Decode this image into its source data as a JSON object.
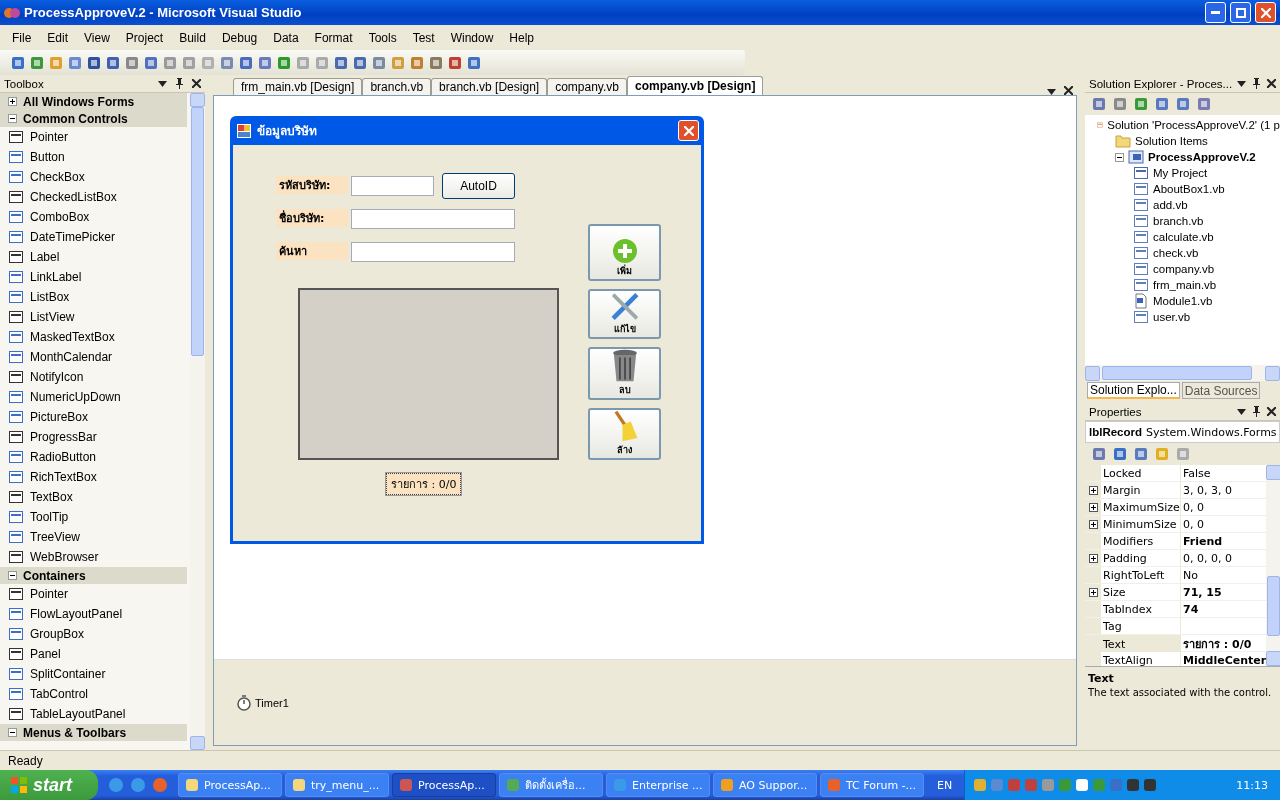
{
  "window": {
    "title": "ProcessApproveV.2 - Microsoft Visual Studio"
  },
  "menu": [
    "File",
    "Edit",
    "View",
    "Project",
    "Build",
    "Debug",
    "Data",
    "Format",
    "Tools",
    "Test",
    "Window",
    "Help"
  ],
  "toolbox": {
    "title": "Toolbox",
    "groups": [
      {
        "title": "All Windows Forms",
        "expanded": false
      },
      {
        "title": "Common Controls",
        "expanded": true,
        "items": [
          "Pointer",
          "Button",
          "CheckBox",
          "CheckedListBox",
          "ComboBox",
          "DateTimePicker",
          "Label",
          "LinkLabel",
          "ListBox",
          "ListView",
          "MaskedTextBox",
          "MonthCalendar",
          "NotifyIcon",
          "NumericUpDown",
          "PictureBox",
          "ProgressBar",
          "RadioButton",
          "RichTextBox",
          "TextBox",
          "ToolTip",
          "TreeView",
          "WebBrowser"
        ]
      },
      {
        "title": "Containers",
        "expanded": true,
        "items": [
          "Pointer",
          "FlowLayoutPanel",
          "GroupBox",
          "Panel",
          "SplitContainer",
          "TabControl",
          "TableLayoutPanel"
        ]
      },
      {
        "title": "Menus & Toolbars",
        "expanded": true
      }
    ]
  },
  "editor_tabs": [
    {
      "label": "frm_main.vb [Design]",
      "selected": false
    },
    {
      "label": "branch.vb",
      "selected": false
    },
    {
      "label": "branch.vb [Design]",
      "selected": false
    },
    {
      "label": "company.vb",
      "selected": false
    },
    {
      "label": "company.vb [Design]",
      "selected": true
    }
  ],
  "form": {
    "title": "ข้อมูลบริษัท",
    "fields": [
      {
        "label": "รหัสบริษัท:",
        "kind": "short",
        "button": "AutoID"
      },
      {
        "label": "ชื่อบริษัท:",
        "kind": "long"
      },
      {
        "label": "ค้นหา",
        "kind": "long"
      }
    ],
    "record_label": "รายการ : 0/0",
    "buttons": [
      {
        "label": "เพิ่ม",
        "kind": "add"
      },
      {
        "label": "แก้ไข",
        "kind": "edit"
      },
      {
        "label": "ลบ",
        "kind": "delete"
      },
      {
        "label": "ล้าง",
        "kind": "clear"
      }
    ]
  },
  "component_tray": [
    "Timer1"
  ],
  "solution_explorer": {
    "title": "Solution Explorer - Proces...",
    "tree": [
      {
        "label": "Solution 'ProcessApproveV.2' (1 p",
        "kind": "solution",
        "children": [
          {
            "label": "Solution Items",
            "kind": "folder"
          },
          {
            "label": "ProcessApproveV.2",
            "kind": "project",
            "expanded": true,
            "children": [
              {
                "label": "My Project",
                "kind": "settings"
              },
              {
                "label": "AboutBox1.vb",
                "kind": "form"
              },
              {
                "label": "add.vb",
                "kind": "form"
              },
              {
                "label": "branch.vb",
                "kind": "form"
              },
              {
                "label": "calculate.vb",
                "kind": "form"
              },
              {
                "label": "check.vb",
                "kind": "form"
              },
              {
                "label": "company.vb",
                "kind": "form"
              },
              {
                "label": "frm_main.vb",
                "kind": "form"
              },
              {
                "label": "Module1.vb",
                "kind": "module"
              },
              {
                "label": "user.vb",
                "kind": "form"
              }
            ]
          }
        ]
      }
    ],
    "tabs": [
      {
        "label": "Solution Explo...",
        "selected": true
      },
      {
        "label": "Data Sources",
        "selected": false
      }
    ]
  },
  "properties": {
    "title": "Properties",
    "object_name": "lblRecord",
    "object_type": "System.Windows.Forms",
    "rows": [
      {
        "name": "Locked",
        "value": "False",
        "expandable": false,
        "bold": false,
        "selected": false
      },
      {
        "name": "Margin",
        "value": "3, 0, 3, 0",
        "expandable": true,
        "bold": false,
        "selected": false
      },
      {
        "name": "MaximumSize",
        "value": "0, 0",
        "expandable": true,
        "bold": false,
        "selected": false
      },
      {
        "name": "MinimumSize",
        "value": "0, 0",
        "expandable": true,
        "bold": false,
        "selected": false
      },
      {
        "name": "Modifiers",
        "value": "Friend",
        "expandable": false,
        "bold": true,
        "selected": false
      },
      {
        "name": "Padding",
        "value": "0, 0, 0, 0",
        "expandable": true,
        "bold": false,
        "selected": false
      },
      {
        "name": "RightToLeft",
        "value": "No",
        "expandable": false,
        "bold": false,
        "selected": false
      },
      {
        "name": "Size",
        "value": "71, 15",
        "expandable": true,
        "bold": true,
        "selected": false
      },
      {
        "name": "TabIndex",
        "value": "74",
        "expandable": false,
        "bold": true,
        "selected": false
      },
      {
        "name": "Tag",
        "expandable": false,
        "selected": false
      },
      {
        "name": "Text",
        "value": "รายการ : 0/0",
        "expandable": false,
        "bold": true,
        "selected": true
      },
      {
        "name": "TextAlign",
        "value": "MiddleCenter",
        "expandable": false,
        "bold": true,
        "selected": false
      }
    ],
    "description_title": "Text",
    "description": "The text associated with the control."
  },
  "status_bar": "Ready",
  "taskbar": {
    "start": "start",
    "tasks": [
      {
        "label": "ProcessAp...",
        "kind": "folder",
        "selected": false
      },
      {
        "label": "try_menu_...",
        "kind": "folder",
        "selected": false
      },
      {
        "label": "ProcessAp...",
        "kind": "vs",
        "selected": true
      },
      {
        "label": "ติดตั้งเครื่อ...",
        "kind": "doc",
        "selected": false
      },
      {
        "label": "Enterprise ...",
        "kind": "ie",
        "selected": false
      },
      {
        "label": "AO Suppor...",
        "kind": "app",
        "selected": false
      },
      {
        "label": "TC Forum -...",
        "kind": "firefox",
        "selected": false
      }
    ],
    "language": "EN",
    "time": "11:13"
  }
}
